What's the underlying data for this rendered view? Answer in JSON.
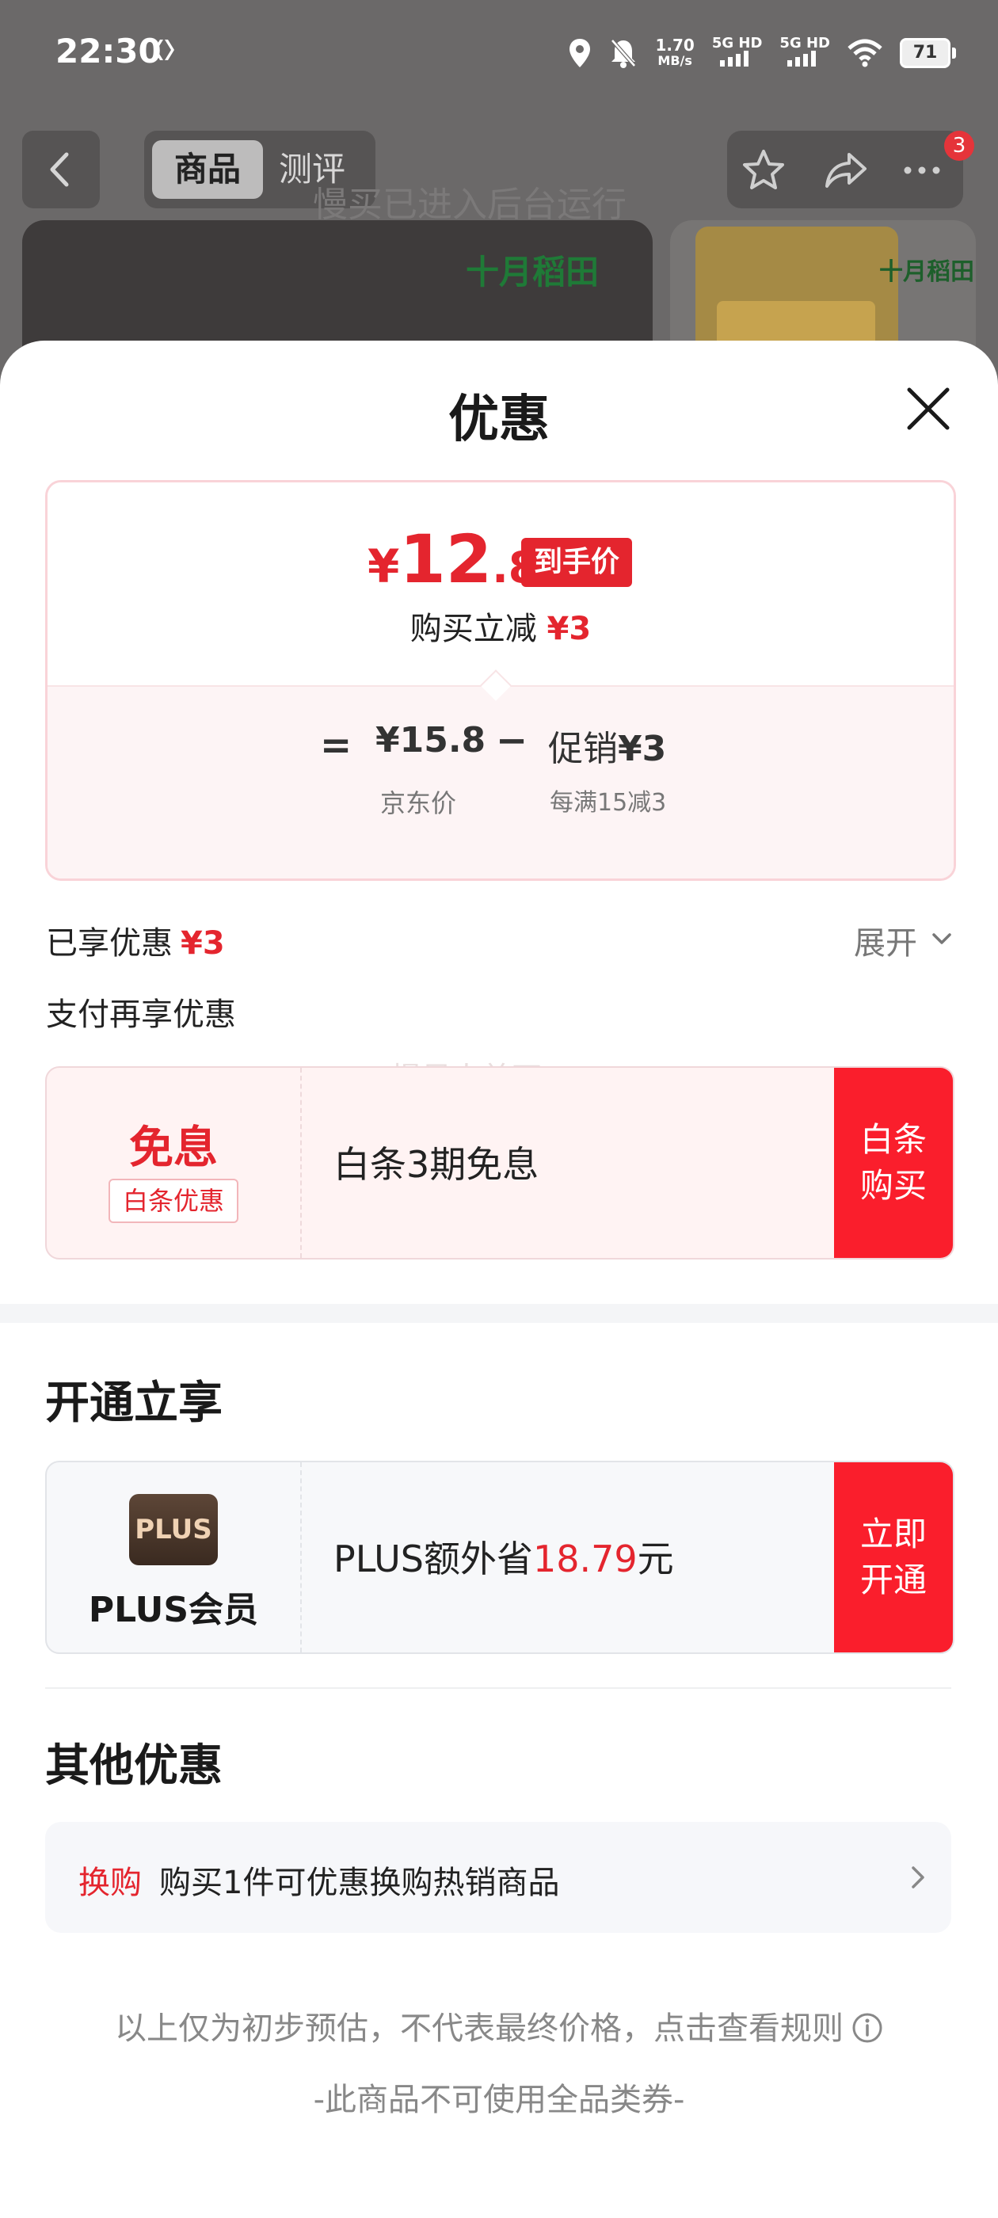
{
  "status_bar": {
    "time": "22:30",
    "speed_value": "1.70",
    "speed_unit": "MB/s",
    "net1": "5G HD",
    "net2": "5G HD",
    "battery": "71"
  },
  "background_page": {
    "tabs": [
      "商品",
      "测评"
    ],
    "cart_badge": "3",
    "toast": "慢买已进入后台运行",
    "brand": "十月稻田",
    "thumb_brand": "十月稻田"
  },
  "sheet": {
    "title": "优惠",
    "price_card": {
      "currency": "¥",
      "final_int": "12",
      "final_dec": ".8",
      "final_tag": "到手价",
      "reduce_label": "购买立减",
      "reduce_value": "¥3",
      "equals": "=",
      "jd_price": "¥15.8",
      "minus": "−",
      "promo_label": "促销",
      "promo_value": "¥3",
      "jd_price_label": "京东价",
      "promo_desc": "每满15减3"
    },
    "enjoyed_label": "已享优惠",
    "enjoyed_value": "¥3",
    "expand_label": "展开",
    "pay_more_label": "支付再享优惠",
    "watermark": "慢星人美石",
    "baitiao": {
      "title": "免息",
      "tag": "白条优惠",
      "text": "白条3期免息",
      "button": "白条\n购买"
    },
    "open_section_title": "开通立享",
    "plus": {
      "logo": "PLUS",
      "name": "PLUS会员",
      "text_prefix": "PLUS额外省",
      "text_amount": "18.79",
      "text_suffix": "元",
      "button": "立即\n开通"
    },
    "other_section_title": "其他优惠",
    "other": {
      "tag": "换购",
      "text": "购买1件可优惠换购热销商品"
    },
    "footnote": "以上仅为初步预估，不代表最终价格，点击查看规则",
    "no_coupon": "-此商品不可使用全品类券-"
  },
  "colors": {
    "accent_red": "#e4252e",
    "button_red": "#fa1e2c",
    "card_pink_bg": "#fdf4f5"
  }
}
